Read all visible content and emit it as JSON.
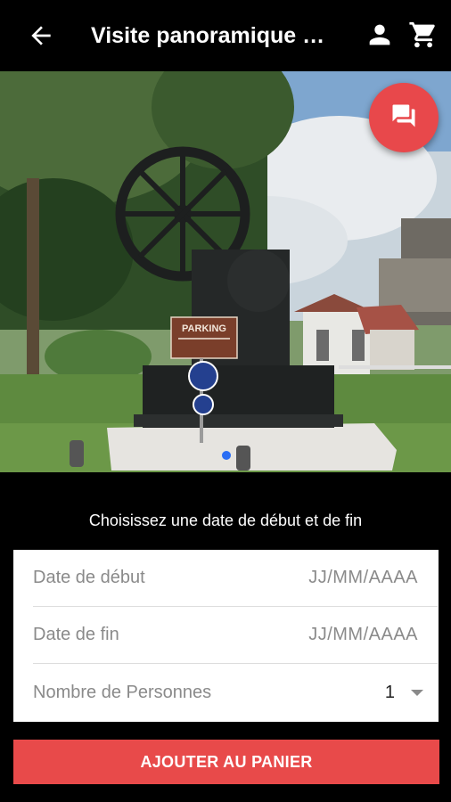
{
  "appbar": {
    "title": "Visite panoramique …",
    "back_icon": "arrow-back-icon",
    "user_icon": "person-icon",
    "cart_icon": "shopping-cart-icon"
  },
  "hero": {
    "sign_text": "PARKING",
    "chat_icon": "chat-icon",
    "carousel_dots": 1,
    "carousel_active": 1
  },
  "booking": {
    "prompt": "Choisissez une date de début et de fin",
    "start_label": "Date de début",
    "start_placeholder": "JJ/MM/AAAA",
    "end_label": "Date de fin",
    "end_placeholder": "JJ/MM/AAAA",
    "persons_label": "Nombre de Personnes",
    "persons_value": "1"
  },
  "actions": {
    "add_to_cart": "AJOUTER AU PANIER"
  },
  "colors": {
    "accent": "#e84a4a",
    "background": "#000000",
    "dot_active": "#2a6df4"
  }
}
